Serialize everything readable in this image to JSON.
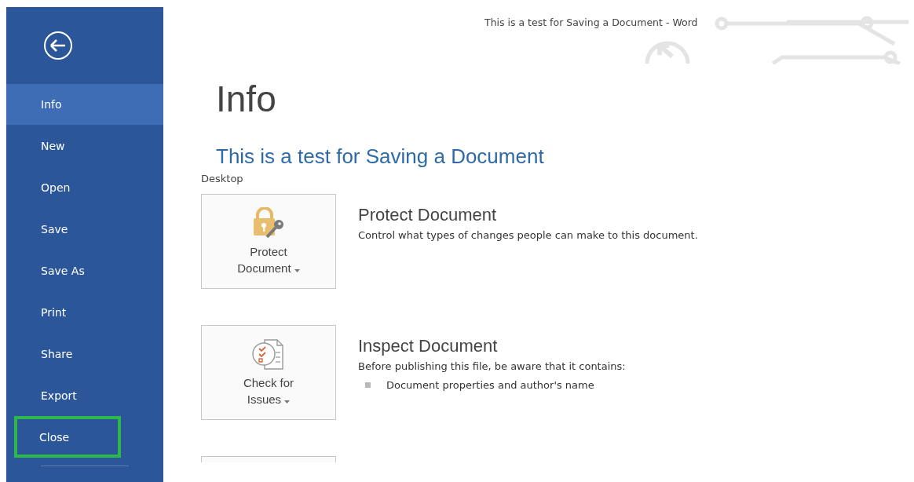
{
  "window": {
    "title": "This is a test for Saving a Document - Word"
  },
  "sidebar": {
    "items": [
      {
        "label": "Info",
        "selected": true,
        "highlighted": false
      },
      {
        "label": "New",
        "selected": false,
        "highlighted": false
      },
      {
        "label": "Open",
        "selected": false,
        "highlighted": false
      },
      {
        "label": "Save",
        "selected": false,
        "highlighted": false
      },
      {
        "label": "Save As",
        "selected": false,
        "highlighted": false
      },
      {
        "label": "Print",
        "selected": false,
        "highlighted": false
      },
      {
        "label": "Share",
        "selected": false,
        "highlighted": false
      },
      {
        "label": "Export",
        "selected": false,
        "highlighted": false
      },
      {
        "label": "Close",
        "selected": false,
        "highlighted": true
      }
    ]
  },
  "page": {
    "heading": "Info",
    "document_title": "This is a test for Saving a Document",
    "location": "Desktop"
  },
  "sections": [
    {
      "kind": "protect",
      "button": "Protect Document",
      "title": "Protect Document",
      "description": "Control what types of changes people can make to this document."
    },
    {
      "kind": "inspect",
      "button": "Check for Issues",
      "title": "Inspect Document",
      "description": "Before publishing this file, be aware that it contains:",
      "bullets": [
        "Document properties and author's name"
      ]
    },
    {
      "kind": "partial"
    }
  ]
}
